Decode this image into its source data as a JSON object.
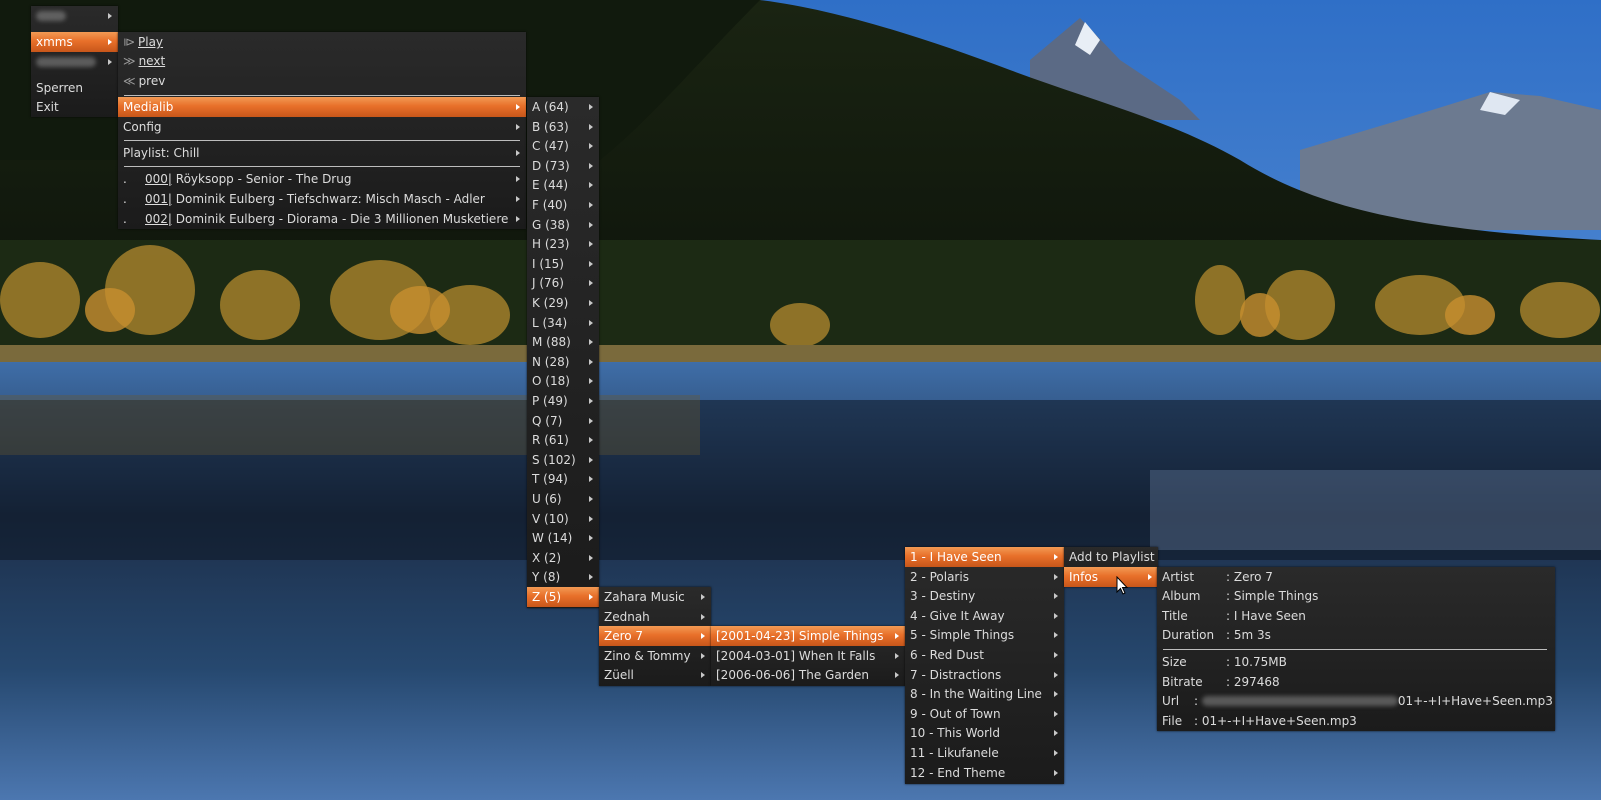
{
  "colors": {
    "accent": "#e8702a",
    "menu_bg": "#1f1f1f"
  },
  "root_menu": {
    "items": [
      {
        "label": "",
        "blurred": true,
        "submenu": true
      },
      {
        "label": "xmms",
        "submenu": true,
        "selected": true
      },
      {
        "label": "",
        "blurred": true,
        "submenu": true
      },
      {
        "label": "Sperren"
      },
      {
        "label": "Exit"
      }
    ]
  },
  "xmms_menu": {
    "play_glyph": "⧐",
    "play": "Play",
    "next_glyph": "≫",
    "next": "next",
    "prev_glyph": "≪",
    "prev": "prev",
    "medialib": "Medialib",
    "config": "Config",
    "playlist": "Playlist: Chill",
    "tracks": [
      {
        "dot": ".",
        "num": "000|",
        "title": "Röyksopp - Senior - The Drug"
      },
      {
        "dot": ".",
        "num": "001|",
        "title": "Dominik Eulberg - Tiefschwarz: Misch Masch - Adler"
      },
      {
        "dot": ".",
        "num": "002|",
        "title": "Dominik Eulberg - Diorama - Die 3 Millionen Musketiere"
      }
    ]
  },
  "letters_menu": {
    "items": [
      "A (64)",
      "B (63)",
      "C (47)",
      "D (73)",
      "E (44)",
      "F (40)",
      "G (38)",
      "H (23)",
      "I (15)",
      "J (76)",
      "K (29)",
      "L (34)",
      "M (88)",
      "N (28)",
      "O (18)",
      "P (49)",
      "Q (7)",
      "R (61)",
      "S (102)",
      "T (94)",
      "U (6)",
      "V (10)",
      "W (14)",
      "X (2)",
      "Y (8)",
      "Z (5)"
    ]
  },
  "artists_menu": {
    "items": [
      "Zahara Music",
      "Zednah",
      "Zero 7",
      "Zino & Tommy",
      "Züell"
    ]
  },
  "albums_menu": {
    "items": [
      "[2001-04-23] Simple Things",
      "[2004-03-01] When It Falls",
      "[2006-06-06] The Garden"
    ]
  },
  "tracks_menu": {
    "items": [
      "1 - I Have Seen",
      "2 - Polaris",
      "3 - Destiny",
      "4 - Give It Away",
      "5 - Simple Things",
      "6 - Red Dust",
      "7 - Distractions",
      "8 - In the Waiting Line",
      "9 - Out of Town",
      "10 - This World",
      "11 - Likufanele",
      "12 - End Theme"
    ]
  },
  "track_actions_menu": {
    "add": "Add to Playlist",
    "infos": "Infos"
  },
  "infos_menu": {
    "artist_k": "Artist",
    "artist_v": ": Zero 7",
    "album_k": "Album",
    "album_v": ": Simple Things",
    "title_k": "Title",
    "title_v": ": I Have Seen",
    "duration_k": "Duration",
    "duration_v": ": 5m 3s",
    "size_k": "Size",
    "size_v": ": 10.75MB",
    "bitrate_k": "Bitrate",
    "bitrate_v": ": 297468",
    "url_k": "Url",
    "url_prefix": ":",
    "url_v": "01+-+I+Have+Seen.mp3",
    "file_k": "File",
    "file_v": ": 01+-+I+Have+Seen.mp3"
  }
}
